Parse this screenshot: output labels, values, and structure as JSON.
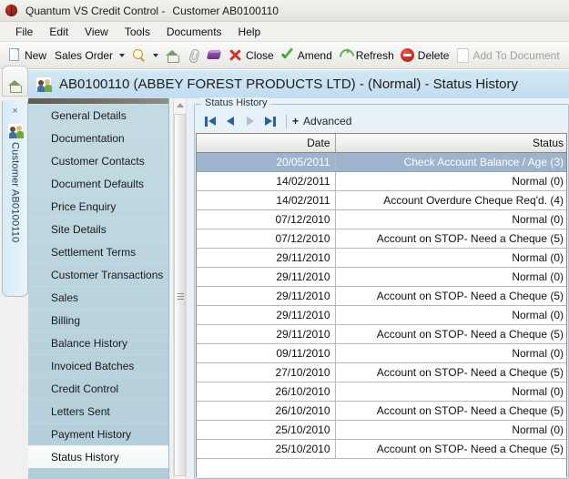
{
  "window": {
    "title": "Quantum VS Credit Control -",
    "subtitle": "Customer AB0100110",
    "app_icon": "ladybird-icon"
  },
  "menu": {
    "items": [
      {
        "label": "File"
      },
      {
        "label": "Edit"
      },
      {
        "label": "View"
      },
      {
        "label": "Tools"
      },
      {
        "label": "Documents"
      },
      {
        "label": "Help"
      }
    ]
  },
  "toolbar": {
    "new_label": "New",
    "doc_type_label": "Sales Order",
    "close_label": "Close",
    "amend_label": "Amend",
    "refresh_label": "Refresh",
    "delete_label": "Delete",
    "add_to_document_label": "Add To Document"
  },
  "vtabs": {
    "home_label": "home-tab",
    "close_glyph": "×",
    "customer_tab_label": "Customer AB0100110"
  },
  "page_header": {
    "title": "AB0100110 (ABBEY FOREST PRODUCTS LTD) - (Normal) - Status History"
  },
  "sidebar": {
    "items": [
      {
        "label": "General Details",
        "selected": false
      },
      {
        "label": "Documentation",
        "selected": false
      },
      {
        "label": "Customer Contacts",
        "selected": false
      },
      {
        "label": "Document Defaults",
        "selected": false
      },
      {
        "label": "Price Enquiry",
        "selected": false
      },
      {
        "label": "Site Details",
        "selected": false
      },
      {
        "label": "Settlement Terms",
        "selected": false
      },
      {
        "label": "Customer Transactions",
        "selected": false
      },
      {
        "label": "Sales",
        "selected": false
      },
      {
        "label": "Billing",
        "selected": false
      },
      {
        "label": "Balance History",
        "selected": false
      },
      {
        "label": "Invoiced Batches",
        "selected": false
      },
      {
        "label": "Credit Control",
        "selected": false
      },
      {
        "label": "Letters Sent",
        "selected": false
      },
      {
        "label": "Payment History",
        "selected": false
      },
      {
        "label": "Status History",
        "selected": true
      }
    ]
  },
  "panel": {
    "group_title": "Status History",
    "pager": {
      "first_label": "first-record",
      "prev_label": "previous-record",
      "next_label": "next-record",
      "last_label": "last-record",
      "next_disabled": true
    },
    "advanced": {
      "plus": "+",
      "label": "Advanced"
    }
  },
  "table": {
    "columns": [
      {
        "key": "date",
        "label": "Date"
      },
      {
        "key": "status",
        "label": "Status"
      }
    ],
    "rows": [
      {
        "date": "20/05/2011",
        "status": "Check Account Balance / Age (3)",
        "selected": true
      },
      {
        "date": "14/02/2011",
        "status": "Normal (0)",
        "selected": false
      },
      {
        "date": "14/02/2011",
        "status": "Account Overdure Cheque Req'd. (4)",
        "selected": false
      },
      {
        "date": "07/12/2010",
        "status": "Normal (0)",
        "selected": false
      },
      {
        "date": "07/12/2010",
        "status": "Account on STOP- Need a Cheque (5)",
        "selected": false
      },
      {
        "date": "29/11/2010",
        "status": "Normal (0)",
        "selected": false
      },
      {
        "date": "29/11/2010",
        "status": "Normal (0)",
        "selected": false
      },
      {
        "date": "29/11/2010",
        "status": "Account on STOP- Need a Cheque (5)",
        "selected": false
      },
      {
        "date": "29/11/2010",
        "status": "Normal (0)",
        "selected": false
      },
      {
        "date": "29/11/2010",
        "status": "Account on STOP- Need a Cheque (5)",
        "selected": false
      },
      {
        "date": "09/11/2010",
        "status": "Normal (0)",
        "selected": false
      },
      {
        "date": "27/10/2010",
        "status": "Account on STOP- Need a Cheque (5)",
        "selected": false
      },
      {
        "date": "26/10/2010",
        "status": "Normal (0)",
        "selected": false
      },
      {
        "date": "26/10/2010",
        "status": "Account on STOP- Need a Cheque (5)",
        "selected": false
      },
      {
        "date": "25/10/2010",
        "status": "Normal (0)",
        "selected": false
      },
      {
        "date": "25/10/2010",
        "status": "Account on STOP- Need a Cheque (5)",
        "selected": false
      }
    ]
  },
  "colors": {
    "selected_row": "#9db4cc",
    "header_band": "#c2dcf0",
    "nav_panel": "#bcd5df",
    "accent_blue": "#2c5f9e"
  }
}
